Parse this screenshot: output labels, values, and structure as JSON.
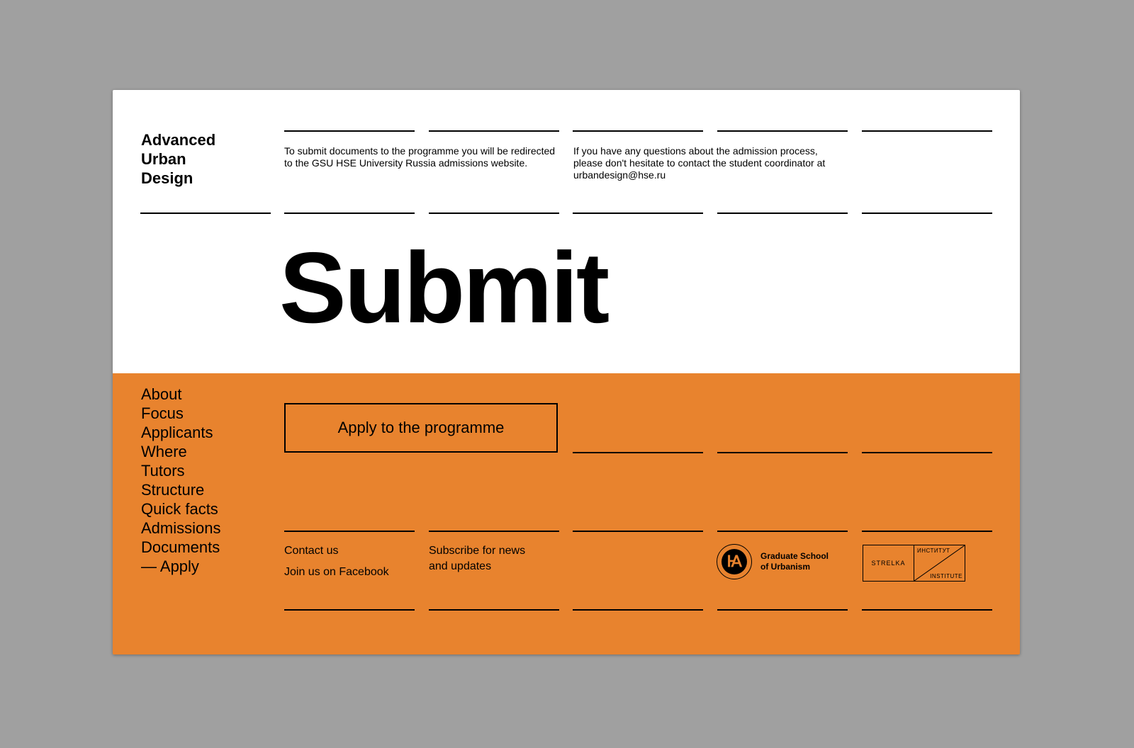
{
  "brand": {
    "lines": [
      "Advanced",
      "Urban",
      "Design"
    ]
  },
  "info": {
    "redirect_text": [
      "To submit documents to the programme you will be redirected",
      "to the GSU HSE University Russia admissions website."
    ],
    "contact_text": [
      "If you have any questions about the admission process,",
      "please don't hesitate to contact the student coordinator at",
      "urbandesign@hse.ru"
    ]
  },
  "page_title": "Submit",
  "nav": {
    "items": [
      "About",
      "Focus",
      "Applicants",
      "Where",
      "Tutors",
      "Structure",
      "Quick facts",
      "Admissions",
      "Documents",
      "— Apply"
    ]
  },
  "apply_button": "Apply to the programme",
  "footer": {
    "contact_us": "Contact us",
    "facebook": "Join us on Facebook",
    "subscribe": [
      "Subscribe for news",
      "and updates"
    ],
    "hse_logo": {
      "glyph": "Ꙗ",
      "lines": [
        "Graduate School",
        "of Urbanism"
      ]
    },
    "strelka_logo": {
      "left": "STRELKA",
      "top_right": "ИНСТИТУТ",
      "bottom_right": "INSTITUTE"
    }
  },
  "colors": {
    "background": "#a0a0a0",
    "panel": "#ffffff",
    "accent": "#e8832e",
    "ink": "#000000"
  }
}
